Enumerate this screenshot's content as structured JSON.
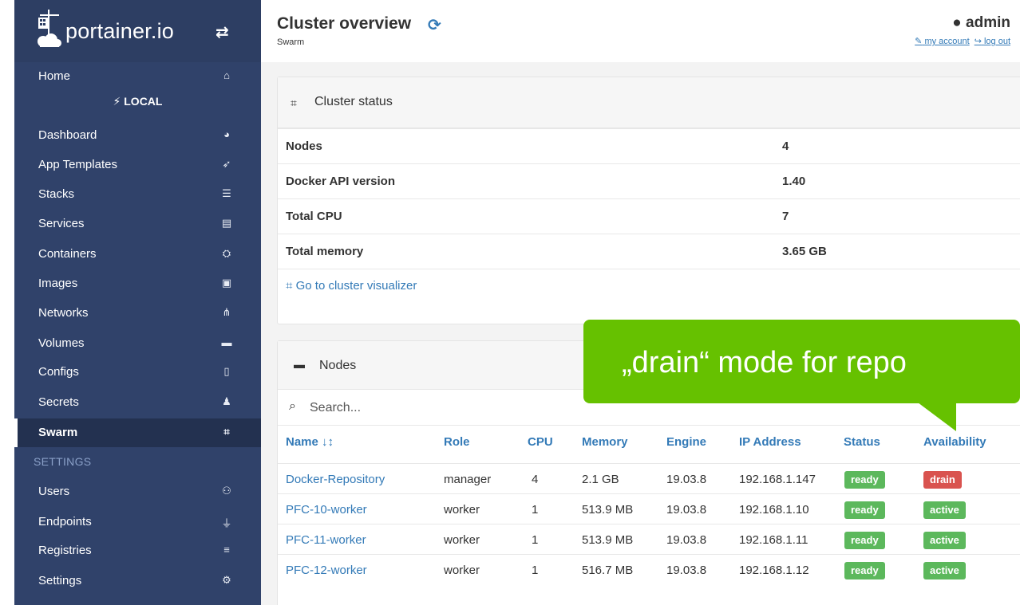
{
  "brand": {
    "name": "portainer.io"
  },
  "sidebar": {
    "home": "Home",
    "endpoint": "LOCAL",
    "items": [
      {
        "label": "Dashboard",
        "icon": "dashboard-icon"
      },
      {
        "label": "App Templates",
        "icon": "rocket-icon"
      },
      {
        "label": "Stacks",
        "icon": "list-icon"
      },
      {
        "label": "Services",
        "icon": "services-icon"
      },
      {
        "label": "Containers",
        "icon": "containers-icon"
      },
      {
        "label": "Images",
        "icon": "images-icon"
      },
      {
        "label": "Networks",
        "icon": "sitemap-icon"
      },
      {
        "label": "Volumes",
        "icon": "hdd-icon"
      },
      {
        "label": "Configs",
        "icon": "file-code-icon"
      },
      {
        "label": "Secrets",
        "icon": "user-secret-icon"
      },
      {
        "label": "Swarm",
        "icon": "object-group-icon",
        "active": true
      }
    ],
    "settings_heading": "SETTINGS",
    "settings_items": [
      {
        "label": "Users",
        "icon": "users-icon"
      },
      {
        "label": "Endpoints",
        "icon": "plug-icon"
      },
      {
        "label": "Registries",
        "icon": "database-icon"
      },
      {
        "label": "Settings",
        "icon": "cogs-icon"
      }
    ]
  },
  "header": {
    "title": "Cluster overview",
    "subtitle": "Swarm",
    "user": "admin",
    "my_account": "my account",
    "log_out": "log out"
  },
  "cluster_status": {
    "title": "Cluster status",
    "rows": [
      {
        "key": "Nodes",
        "value": "4"
      },
      {
        "key": "Docker API version",
        "value": "1.40"
      },
      {
        "key": "Total CPU",
        "value": "7"
      },
      {
        "key": "Total memory",
        "value": "3.65 GB"
      }
    ],
    "visualizer_link": "Go to cluster visualizer"
  },
  "nodes": {
    "title": "Nodes",
    "search_placeholder": "Search...",
    "columns": [
      "Name ↓↕",
      "Role",
      "CPU",
      "Memory",
      "Engine",
      "IP Address",
      "Status",
      "Availability"
    ],
    "rows": [
      {
        "name": "Docker-Repository",
        "role": "manager",
        "cpu": "4",
        "memory": "2.1 GB",
        "engine": "19.03.8",
        "ip": "192.168.1.147",
        "status": "ready",
        "availability": "drain"
      },
      {
        "name": "PFC-10-worker",
        "role": "worker",
        "cpu": "1",
        "memory": "513.9 MB",
        "engine": "19.03.8",
        "ip": "192.168.1.10",
        "status": "ready",
        "availability": "active"
      },
      {
        "name": "PFC-11-worker",
        "role": "worker",
        "cpu": "1",
        "memory": "513.9 MB",
        "engine": "19.03.8",
        "ip": "192.168.1.11",
        "status": "ready",
        "availability": "active"
      },
      {
        "name": "PFC-12-worker",
        "role": "worker",
        "cpu": "1",
        "memory": "516.7 MB",
        "engine": "19.03.8",
        "ip": "192.168.1.12",
        "status": "ready",
        "availability": "active"
      }
    ]
  },
  "callout": {
    "text": "„drain“ mode for repo"
  },
  "colors": {
    "sidebar": "#30426a",
    "link": "#337ab7",
    "ready": "#5cb85c",
    "drain": "#d9534f",
    "callout": "#66c100"
  }
}
